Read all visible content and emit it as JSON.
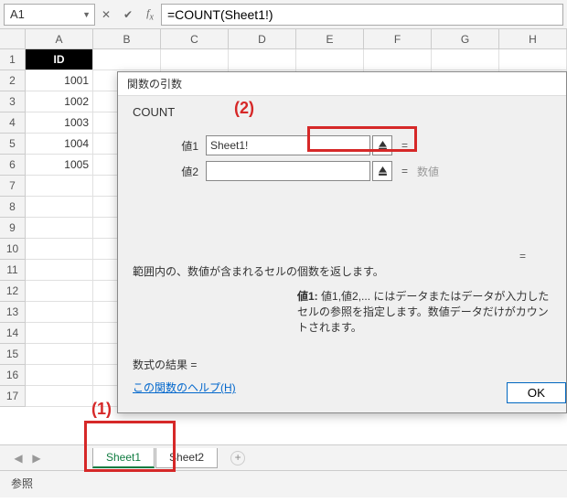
{
  "formula_bar": {
    "cell_ref": "A1",
    "formula": "=COUNT(Sheet1!)"
  },
  "columns": [
    "A",
    "B",
    "C",
    "D",
    "E",
    "F",
    "G",
    "H"
  ],
  "rows": {
    "header_label": "ID",
    "data": [
      "1001",
      "1002",
      "1003",
      "1004",
      "1005"
    ],
    "total_rows": 17
  },
  "sheet_tabs": {
    "tabs": [
      "Sheet1",
      "Sheet2"
    ],
    "active_index": 0
  },
  "status_bar": {
    "mode": "参照"
  },
  "dialog": {
    "title": "関数の引数",
    "function_name": "COUNT",
    "args": [
      {
        "label": "値1",
        "value": "Sheet1!",
        "result": ""
      },
      {
        "label": "値2",
        "value": "",
        "result": "数値"
      }
    ],
    "equals_sign": "=",
    "descriptions": {
      "summary": "範囲内の、数値が含まれるセルの個数を返します。",
      "arg_label": "値1:",
      "arg_text": "値1,値2,... にはデータまたはデータが入力したセルの参照を指定します。数値データだけがカウントされます。"
    },
    "result_label": "数式の結果 =",
    "help_link": "この関数のヘルプ(H)",
    "ok_label": "OK"
  },
  "annotations": {
    "label1": "(1)",
    "label2": "(2)"
  }
}
